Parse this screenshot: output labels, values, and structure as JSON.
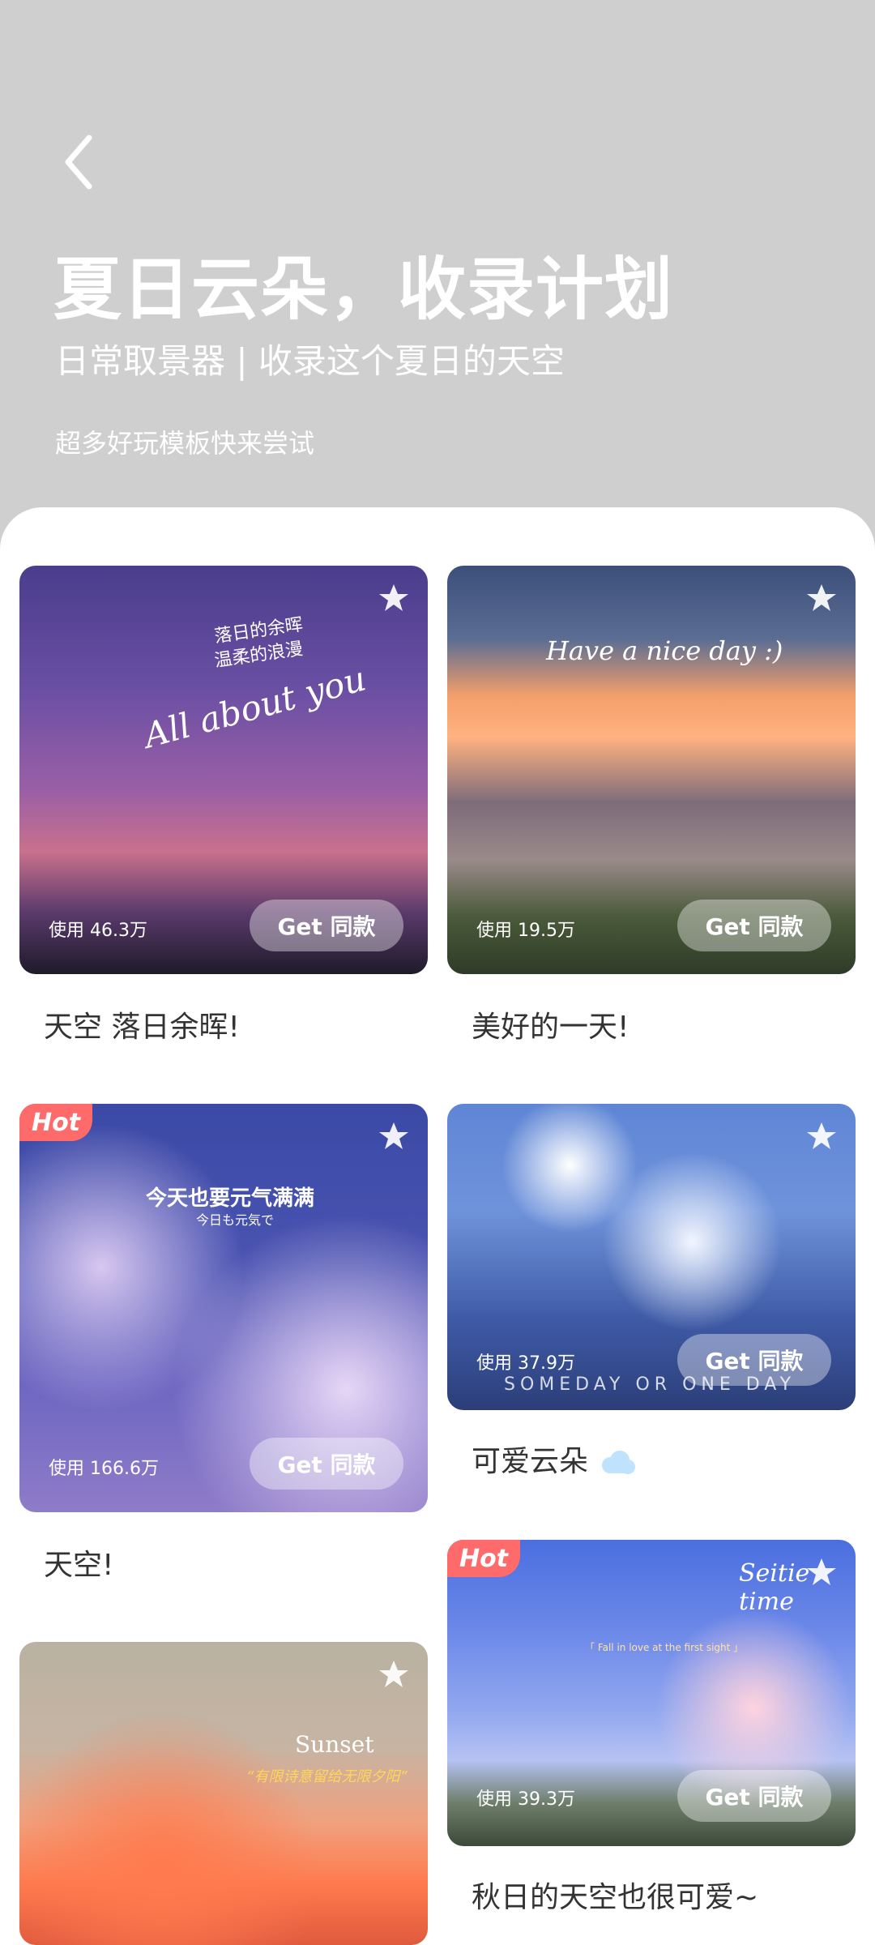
{
  "header": {
    "title": "夏日云朵，收录计划",
    "subtitle": "日常取景器 | 收录这个夏日的天空",
    "hint": "超多好玩模板快来尝试"
  },
  "cards": [
    {
      "id": "c1",
      "overlay": {
        "line1": "落日的余晖",
        "line2": "温柔的浪漫",
        "script": "All about you"
      },
      "uses": "使用 46.3万",
      "cta": "Get 同款",
      "caption": "天空 落日余晖!",
      "hot": ""
    },
    {
      "id": "c2",
      "overlay": {
        "script": "Have a nice day :)"
      },
      "uses": "使用 19.5万",
      "cta": "Get 同款",
      "caption": "美好的一天!",
      "hot": ""
    },
    {
      "id": "c3",
      "overlay": {
        "line1": "今天也要元气满满",
        "line2": "今日も元気で"
      },
      "uses": "使用 166.6万",
      "cta": "Get 同款",
      "caption": "天空!",
      "hot": "Hot"
    },
    {
      "id": "c4",
      "overlay": {
        "bottom": "SOMEDAY OR ONE DAY"
      },
      "uses": "使用 37.9万",
      "cta": "Get 同款",
      "caption": "可爱云朵",
      "hot": ""
    },
    {
      "id": "c5",
      "overlay": {
        "script": "Sunset",
        "line1": "“有限诗意留给无限夕阳”"
      },
      "uses": "",
      "cta": "",
      "caption": "",
      "hot": ""
    },
    {
      "id": "c6",
      "overlay": {
        "small": "「 Fall in love at the first sight 」",
        "script": "Seitie time"
      },
      "uses": "使用 39.3万",
      "cta": "Get 同款",
      "caption": "秋日的天空也很可爱~",
      "hot": "Hot"
    }
  ],
  "icons": {
    "back": "chevron-left-icon",
    "favorite": "star-icon",
    "cloud": "cloud-icon"
  },
  "colors": {
    "sheet_bg": "#ffffff",
    "header_bg": "#cfcfcf",
    "hot_badge": "#ff6b6b"
  }
}
